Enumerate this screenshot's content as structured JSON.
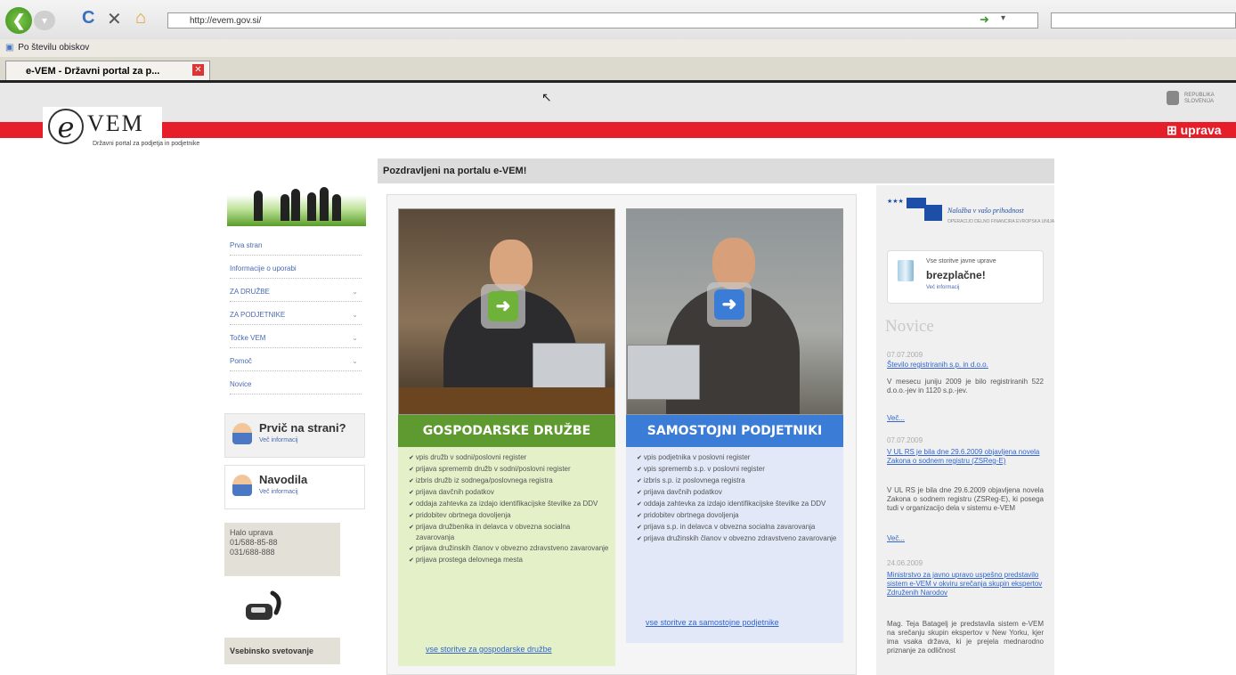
{
  "browser": {
    "url": "http://evem.gov.si/",
    "favorites_item": "Po številu obiskov",
    "tab_title": "e-VEM - Državni portal za p...",
    "tab_prefix": "vem"
  },
  "header": {
    "logo_letter": "e",
    "logo_text": "VEM",
    "logo_subtitle": "Državni portal za podjetja in podjetnike",
    "uprava": "uprava",
    "republika": "REPUBLIKA SLOVENIJA"
  },
  "sidebar": {
    "items": [
      {
        "label": "Prva stran",
        "chevron": ""
      },
      {
        "label": "Informacije o uporabi",
        "chevron": ""
      },
      {
        "label": "ZA DRUŽBE",
        "chevron": "⌄"
      },
      {
        "label": "ZA PODJETNIKE",
        "chevron": "⌄"
      },
      {
        "label": "Točke VEM",
        "chevron": "⌄"
      },
      {
        "label": "Pomoč",
        "chevron": "⌄"
      },
      {
        "label": "Novice",
        "chevron": ""
      }
    ],
    "box1": {
      "title": "Prvič na strani?",
      "sub": "Več informacij"
    },
    "box2": {
      "title": "Navodila",
      "sub": "Več informacij"
    },
    "halo": {
      "line1": "Halo uprava",
      "line2": "01/588-85-88",
      "line3": "031/688-888"
    },
    "vsebinsko": "Vsebinsko svetovanje"
  },
  "main": {
    "welcome": "Pozdravljeni na portalu e-VEM!",
    "cat1": {
      "title": "GOSPODARSKE DRUŽBE",
      "items": [
        "vpis družb v sodni/poslovni register",
        "prijava sprememb družb v sodni/poslovni register",
        "izbris družb iz sodnega/poslovnega registra",
        "prijava davčnih podatkov",
        "oddaja zahtevka za izdajo identifikacijske številke za DDV",
        "pridobitev obrtnega dovoljenja",
        "prijava družbenika in delavca v obvezna socialna zavarovanja",
        "prijava družinskih članov v obvezno zdravstveno zavarovanje",
        "prijava prostega delovnega mesta"
      ],
      "link": "vse storitve za gospodarske družbe"
    },
    "cat2": {
      "title": "SAMOSTOJNI PODJETNIKI",
      "items": [
        "vpis podjetnika v poslovni register",
        "vpis sprememb s.p. v poslovni register",
        "izbris s.p. iz poslovnega registra",
        "prijava davčnih podatkov",
        "oddaja zahtevka za izdajo identifikacijske številke za DDV",
        "pridobitev obrtnega dovoljenja",
        "prijava s.p. in delavca v obvezna socialna zavarovanja",
        "prijava družinskih članov v obvezno zdravstveno zavarovanje"
      ],
      "link": "vse storitve za samostojne podjetnike"
    }
  },
  "right": {
    "eu_text": "Naložba v vašo prihodnost",
    "eu_sub": "OPERACIJO DELNO FINANCIRA EVROPSKA UNIJA",
    "free_l1": "Vse storitve javne uprave",
    "free_l2": "brezplačne!",
    "free_l3": "Več informacij",
    "novice_title": "Novice",
    "news": [
      {
        "date": "07.07.2009",
        "link": "Število registriranih s.p. in d.o.o.",
        "text": "V mesecu juniju 2009 je bilo registriranih 522 d.o.o.-jev in 1120 s.p.-jev.",
        "more": "Več..."
      },
      {
        "date": "07.07.2009",
        "link": "V UL RS je bila dne 29.6.2009 objavljena novela Zakona o sodnem registru (ZSReg-E)",
        "text": "V UL RS je bila dne 29.6.2009 objavljena novela Zakona o sodnem registru (ZSReg-E), ki posega tudi v organizacijo dela v sistemu e-VEM",
        "more": "Več..."
      },
      {
        "date": "24.06.2009",
        "link": "Ministrstvo za javno upravo uspešno predstavilo sistem e-VEM v okviru srečanja skupin ekspertov Združenih Narodov",
        "text": "Mag. Teja Batagelj je predstavila sistem e-VEM na srečanju skupin ekspertov v New Yorku, kjer ima vsaka država, ki je prejela mednarodno priznanje za odličnost",
        "more": ""
      }
    ]
  }
}
